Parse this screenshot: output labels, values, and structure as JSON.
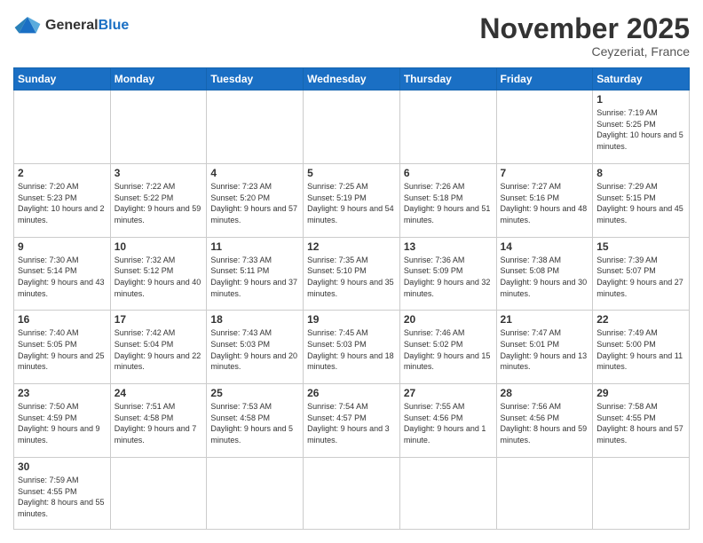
{
  "header": {
    "logo": {
      "general": "General",
      "blue": "Blue"
    },
    "title": "November 2025",
    "subtitle": "Ceyzeriat, France"
  },
  "calendar": {
    "weekdays": [
      "Sunday",
      "Monday",
      "Tuesday",
      "Wednesday",
      "Thursday",
      "Friday",
      "Saturday"
    ],
    "weeks": [
      [
        {
          "day": "",
          "info": ""
        },
        {
          "day": "",
          "info": ""
        },
        {
          "day": "",
          "info": ""
        },
        {
          "day": "",
          "info": ""
        },
        {
          "day": "",
          "info": ""
        },
        {
          "day": "",
          "info": ""
        },
        {
          "day": "1",
          "info": "Sunrise: 7:19 AM\nSunset: 5:25 PM\nDaylight: 10 hours and 5 minutes."
        }
      ],
      [
        {
          "day": "2",
          "info": "Sunrise: 7:20 AM\nSunset: 5:23 PM\nDaylight: 10 hours and 2 minutes."
        },
        {
          "day": "3",
          "info": "Sunrise: 7:22 AM\nSunset: 5:22 PM\nDaylight: 9 hours and 59 minutes."
        },
        {
          "day": "4",
          "info": "Sunrise: 7:23 AM\nSunset: 5:20 PM\nDaylight: 9 hours and 57 minutes."
        },
        {
          "day": "5",
          "info": "Sunrise: 7:25 AM\nSunset: 5:19 PM\nDaylight: 9 hours and 54 minutes."
        },
        {
          "day": "6",
          "info": "Sunrise: 7:26 AM\nSunset: 5:18 PM\nDaylight: 9 hours and 51 minutes."
        },
        {
          "day": "7",
          "info": "Sunrise: 7:27 AM\nSunset: 5:16 PM\nDaylight: 9 hours and 48 minutes."
        },
        {
          "day": "8",
          "info": "Sunrise: 7:29 AM\nSunset: 5:15 PM\nDaylight: 9 hours and 45 minutes."
        }
      ],
      [
        {
          "day": "9",
          "info": "Sunrise: 7:30 AM\nSunset: 5:14 PM\nDaylight: 9 hours and 43 minutes."
        },
        {
          "day": "10",
          "info": "Sunrise: 7:32 AM\nSunset: 5:12 PM\nDaylight: 9 hours and 40 minutes."
        },
        {
          "day": "11",
          "info": "Sunrise: 7:33 AM\nSunset: 5:11 PM\nDaylight: 9 hours and 37 minutes."
        },
        {
          "day": "12",
          "info": "Sunrise: 7:35 AM\nSunset: 5:10 PM\nDaylight: 9 hours and 35 minutes."
        },
        {
          "day": "13",
          "info": "Sunrise: 7:36 AM\nSunset: 5:09 PM\nDaylight: 9 hours and 32 minutes."
        },
        {
          "day": "14",
          "info": "Sunrise: 7:38 AM\nSunset: 5:08 PM\nDaylight: 9 hours and 30 minutes."
        },
        {
          "day": "15",
          "info": "Sunrise: 7:39 AM\nSunset: 5:07 PM\nDaylight: 9 hours and 27 minutes."
        }
      ],
      [
        {
          "day": "16",
          "info": "Sunrise: 7:40 AM\nSunset: 5:05 PM\nDaylight: 9 hours and 25 minutes."
        },
        {
          "day": "17",
          "info": "Sunrise: 7:42 AM\nSunset: 5:04 PM\nDaylight: 9 hours and 22 minutes."
        },
        {
          "day": "18",
          "info": "Sunrise: 7:43 AM\nSunset: 5:03 PM\nDaylight: 9 hours and 20 minutes."
        },
        {
          "day": "19",
          "info": "Sunrise: 7:45 AM\nSunset: 5:03 PM\nDaylight: 9 hours and 18 minutes."
        },
        {
          "day": "20",
          "info": "Sunrise: 7:46 AM\nSunset: 5:02 PM\nDaylight: 9 hours and 15 minutes."
        },
        {
          "day": "21",
          "info": "Sunrise: 7:47 AM\nSunset: 5:01 PM\nDaylight: 9 hours and 13 minutes."
        },
        {
          "day": "22",
          "info": "Sunrise: 7:49 AM\nSunset: 5:00 PM\nDaylight: 9 hours and 11 minutes."
        }
      ],
      [
        {
          "day": "23",
          "info": "Sunrise: 7:50 AM\nSunset: 4:59 PM\nDaylight: 9 hours and 9 minutes."
        },
        {
          "day": "24",
          "info": "Sunrise: 7:51 AM\nSunset: 4:58 PM\nDaylight: 9 hours and 7 minutes."
        },
        {
          "day": "25",
          "info": "Sunrise: 7:53 AM\nSunset: 4:58 PM\nDaylight: 9 hours and 5 minutes."
        },
        {
          "day": "26",
          "info": "Sunrise: 7:54 AM\nSunset: 4:57 PM\nDaylight: 9 hours and 3 minutes."
        },
        {
          "day": "27",
          "info": "Sunrise: 7:55 AM\nSunset: 4:56 PM\nDaylight: 9 hours and 1 minute."
        },
        {
          "day": "28",
          "info": "Sunrise: 7:56 AM\nSunset: 4:56 PM\nDaylight: 8 hours and 59 minutes."
        },
        {
          "day": "29",
          "info": "Sunrise: 7:58 AM\nSunset: 4:55 PM\nDaylight: 8 hours and 57 minutes."
        }
      ],
      [
        {
          "day": "30",
          "info": "Sunrise: 7:59 AM\nSunset: 4:55 PM\nDaylight: 8 hours and 55 minutes."
        },
        {
          "day": "",
          "info": ""
        },
        {
          "day": "",
          "info": ""
        },
        {
          "day": "",
          "info": ""
        },
        {
          "day": "",
          "info": ""
        },
        {
          "day": "",
          "info": ""
        },
        {
          "day": "",
          "info": ""
        }
      ]
    ]
  }
}
